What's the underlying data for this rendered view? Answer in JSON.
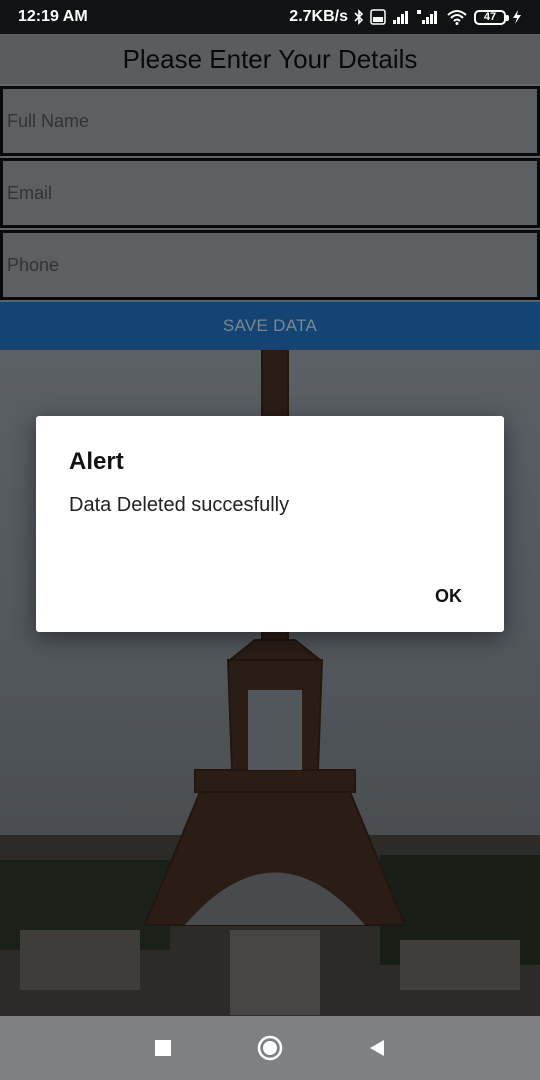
{
  "status_bar": {
    "time": "12:19 AM",
    "network_speed": "2.7KB/s",
    "battery_level": "47",
    "icons": [
      "bluetooth-icon",
      "volte-icon",
      "signal-icon",
      "hd-signal-icon",
      "wifi-icon",
      "battery-icon",
      "charging-icon"
    ]
  },
  "form": {
    "title": "Please Enter Your Details",
    "fields": {
      "full_name_placeholder": "Full Name",
      "email_placeholder": "Email",
      "phone_placeholder": "Phone"
    },
    "save_label": "SAVE DATA"
  },
  "dialog": {
    "title": "Alert",
    "message": "Data Deleted succesfully",
    "ok_label": "OK"
  },
  "nav_bar": {
    "buttons": [
      "recents-square-icon",
      "home-circle-icon",
      "back-triangle-icon"
    ]
  },
  "colors": {
    "save_button": "#2176c8",
    "dialog_bg": "#ffffff",
    "nav_bar": "#7e8184",
    "status_bar": "#101214"
  }
}
